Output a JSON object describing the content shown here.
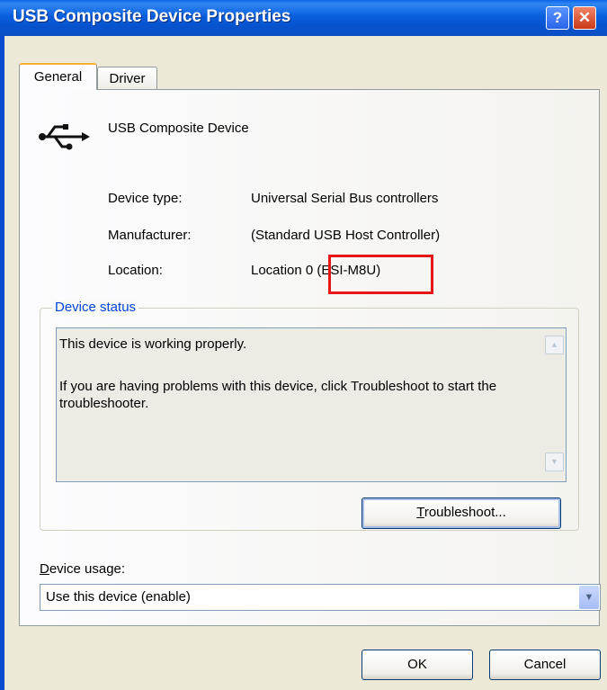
{
  "window": {
    "title": "USB Composite Device Properties",
    "help_glyph": "?",
    "close_glyph": "✕"
  },
  "tabs": [
    {
      "label": "General",
      "selected": true
    },
    {
      "label": "Driver",
      "selected": false
    }
  ],
  "device": {
    "icon": "usb-icon",
    "name": "USB Composite Device",
    "properties": [
      {
        "label": "Device type:",
        "value": "Universal Serial Bus controllers"
      },
      {
        "label": "Manufacturer:",
        "value": "(Standard USB Host Controller)"
      },
      {
        "label": "Location:",
        "value": "Location 0 (ESI-M8U)"
      }
    ]
  },
  "status": {
    "group_label": "Device status",
    "line1": "This device is working properly.",
    "line2": "If you are having problems with this device, click Troubleshoot to start the troubleshooter.",
    "troubleshoot_first": "T",
    "troubleshoot_rest": "roubleshoot..."
  },
  "usage": {
    "label_first": "D",
    "label_rest": "evice usage:",
    "selected": "Use this device (enable)"
  },
  "footer": {
    "ok_label": "OK",
    "cancel_label": "Cancel"
  },
  "colors": {
    "highlight_box": "#e51616",
    "title_bar": "#0a5fde",
    "group_label": "#0046d5"
  }
}
